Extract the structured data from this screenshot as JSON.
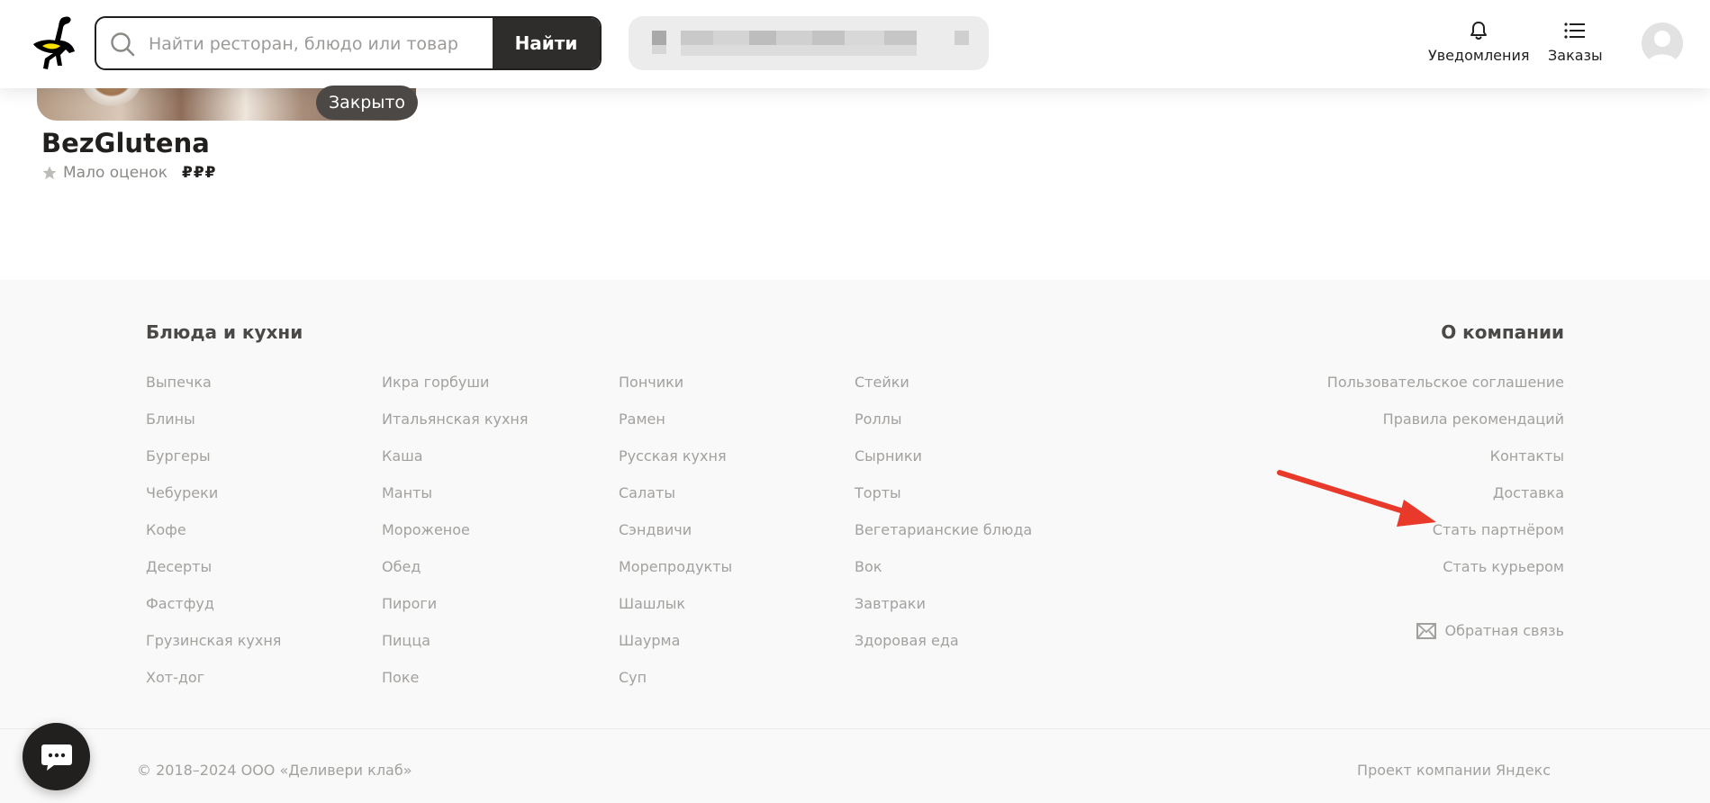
{
  "header": {
    "search": {
      "placeholder": "Найти ресторан, блюдо или товар",
      "button_label": "Найти"
    },
    "notifications_label": "Уведомления",
    "orders_label": "Заказы"
  },
  "restaurant": {
    "name": "BezGlutena",
    "status": "Закрыто",
    "rating_text": "Мало оценок",
    "price": "₽₽₽"
  },
  "footer": {
    "dishes_title": "Блюда и кухни",
    "columns": [
      [
        "Выпечка",
        "Блины",
        "Бургеры",
        "Чебуреки",
        "Кофе",
        "Десерты",
        "Фастфуд",
        "Грузинская кухня",
        "Хот-дог"
      ],
      [
        "Икра горбуши",
        "Итальянская кухня",
        "Каша",
        "Манты",
        "Мороженое",
        "Обед",
        "Пироги",
        "Пицца",
        "Поке"
      ],
      [
        "Пончики",
        "Рамен",
        "Русская кухня",
        "Салаты",
        "Сэндвичи",
        "Морепродукты",
        "Шашлык",
        "Шаурма",
        "Суп"
      ],
      [
        "Стейки",
        "Роллы",
        "Сырники",
        "Торты",
        "Вегетарианские блюда",
        "Вок",
        "Завтраки",
        "Здоровая еда"
      ]
    ],
    "company_title": "О компании",
    "company_links": [
      "Пользовательское соглашение",
      "Правила рекомендаций",
      "Контакты",
      "Доставка",
      "Стать партнёром",
      "Стать курьером"
    ],
    "feedback": "Обратная связь",
    "copyright": "© 2018–2024 ООО «Деливери клаб»",
    "project": "Проект компании Яндекс"
  },
  "colors": {
    "accent_dark": "#21201f",
    "annotation_arrow": "#e8392b",
    "footer_bg": "#f9f9f9"
  }
}
